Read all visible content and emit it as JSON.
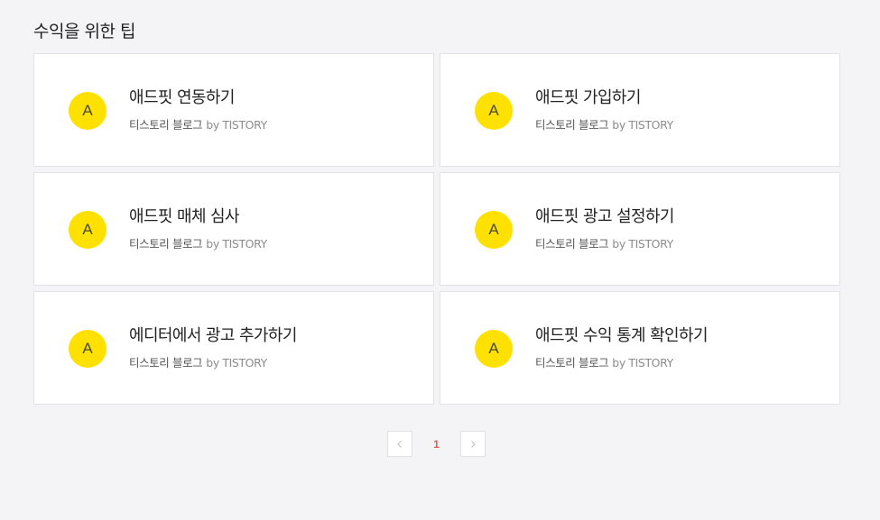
{
  "section": {
    "title": "수익을 위한 팁"
  },
  "cards": [
    {
      "avatar": "A",
      "title": "애드핏 연동하기",
      "blog": "티스토리 블로그",
      "by": "by TISTORY"
    },
    {
      "avatar": "A",
      "title": "애드핏 가입하기",
      "blog": "티스토리 블로그",
      "by": "by TISTORY"
    },
    {
      "avatar": "A",
      "title": "애드핏 매체 심사",
      "blog": "티스토리 블로그",
      "by": "by TISTORY"
    },
    {
      "avatar": "A",
      "title": "애드핏 광고 설정하기",
      "blog": "티스토리 블로그",
      "by": "by TISTORY"
    },
    {
      "avatar": "A",
      "title": "에디터에서 광고 추가하기",
      "blog": "티스토리 블로그",
      "by": "by TISTORY"
    },
    {
      "avatar": "A",
      "title": "애드핏 수익 통계 확인하기",
      "blog": "티스토리 블로그",
      "by": "by TISTORY"
    }
  ],
  "pagination": {
    "current": "1",
    "prev_icon": "chevron-left-icon",
    "next_icon": "chevron-right-icon"
  },
  "colors": {
    "background": "#f4f4f6",
    "avatar": "#ffe100",
    "active_page": "#f05a4a"
  }
}
